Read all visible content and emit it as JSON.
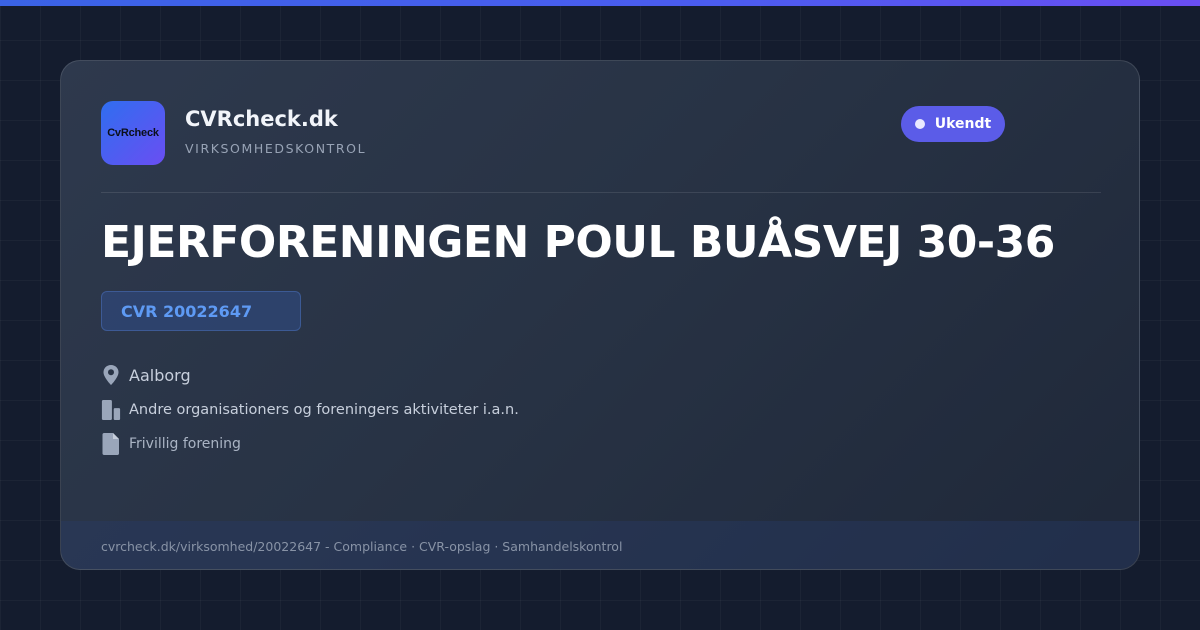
{
  "brand": {
    "logo_text": "CvRcheck",
    "name": "CVRcheck.dk",
    "tagline": "VIRKSOMHEDSKONTROL"
  },
  "status": {
    "label": "Ukendt",
    "color": "#5b5ce8"
  },
  "company": {
    "name": "EJERFORENINGEN POUL BUÅSVEJ 30-36",
    "cvr": "CVR 20022647",
    "city": "Aalborg",
    "industry": "Andre organisationers og foreningers aktiviteter i.a.n.",
    "form": "Frivillig forening"
  },
  "icons": {
    "city": "map-pin-icon",
    "industry": "building-icon",
    "form": "document-icon"
  },
  "footer": {
    "text": "cvrcheck.dk/virksomhed/20022647 - Compliance · CVR-opslag · Samhandelskontrol"
  },
  "colors": {
    "accent": "#4b5cf0",
    "cvr_text": "#5e9af4",
    "background": "#131b2c"
  }
}
